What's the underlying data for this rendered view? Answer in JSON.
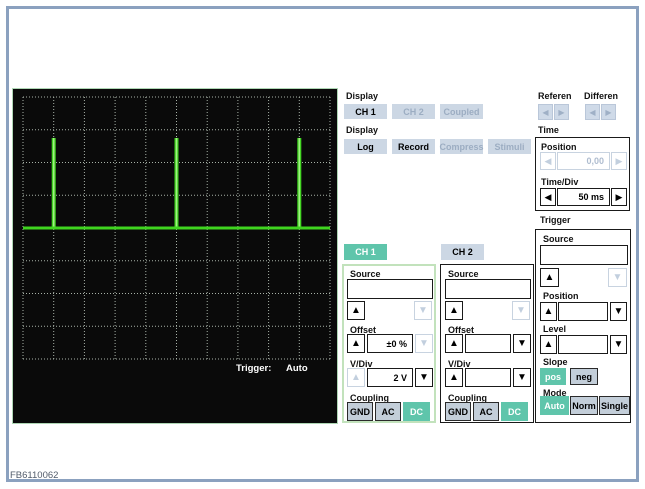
{
  "figure_id": "FB6110062",
  "scope": {
    "trigger_status_label": "Trigger:",
    "trigger_status_value": "Auto",
    "grid_cols": 10,
    "grid_rows": 8,
    "baseline_row": 4,
    "spike_cols": [
      1,
      5,
      9
    ],
    "spike_top_row": 1.25,
    "signal_color": "#3fd41f",
    "grid_color": "#a8b2a8",
    "bg_color": "#0a0a0a"
  },
  "display_channels": {
    "label": "Display",
    "buttons": [
      {
        "label": "CH 1",
        "state": "enabled"
      },
      {
        "label": "CH 2",
        "state": "disabled"
      },
      {
        "label": "Coupled",
        "state": "disabled"
      }
    ]
  },
  "display_modes": {
    "label": "Display",
    "buttons": [
      {
        "label": "Log",
        "state": "enabled"
      },
      {
        "label": "Record",
        "state": "enabled"
      },
      {
        "label": "Compress",
        "state": "disabled"
      },
      {
        "label": "Stimuli",
        "state": "disabled"
      }
    ]
  },
  "reference": {
    "label": "Referen"
  },
  "difference": {
    "label": "Differen"
  },
  "time": {
    "label": "Time",
    "position_label": "Position",
    "position_value": "0,00",
    "timediv_label": "Time/Div",
    "timediv_value": "50 ms"
  },
  "trigger": {
    "label": "Trigger",
    "source_label": "Source",
    "source_value": "",
    "position_label": "Position",
    "position_value": "",
    "level_label": "Level",
    "level_value": "",
    "slope_label": "Slope",
    "slope_options": [
      {
        "label": "pos",
        "active": true
      },
      {
        "label": "neg",
        "active": false
      }
    ],
    "mode_label": "Mode",
    "mode_options": [
      {
        "label": "Auto",
        "active": true
      },
      {
        "label": "Norm",
        "active": false
      },
      {
        "label": "Single",
        "active": false
      }
    ]
  },
  "ch1": {
    "button": "CH 1",
    "source_label": "Source",
    "source_value": "",
    "offset_label": "Offset",
    "offset_value": "±0 %",
    "vdiv_label": "V/Div",
    "vdiv_value": "2 V",
    "coupling_label": "Coupling",
    "coupling_options": [
      {
        "label": "GND",
        "active": false
      },
      {
        "label": "AC",
        "active": false
      },
      {
        "label": "DC",
        "active": true
      }
    ]
  },
  "ch2": {
    "button": "CH 2",
    "source_label": "Source",
    "source_value": "",
    "offset_label": "Offset",
    "offset_value": "",
    "vdiv_label": "V/Div",
    "vdiv_value": "",
    "coupling_label": "Coupling",
    "coupling_options": [
      {
        "label": "GND",
        "active": false
      },
      {
        "label": "AC",
        "active": false
      },
      {
        "label": "DC",
        "active": true
      }
    ]
  }
}
